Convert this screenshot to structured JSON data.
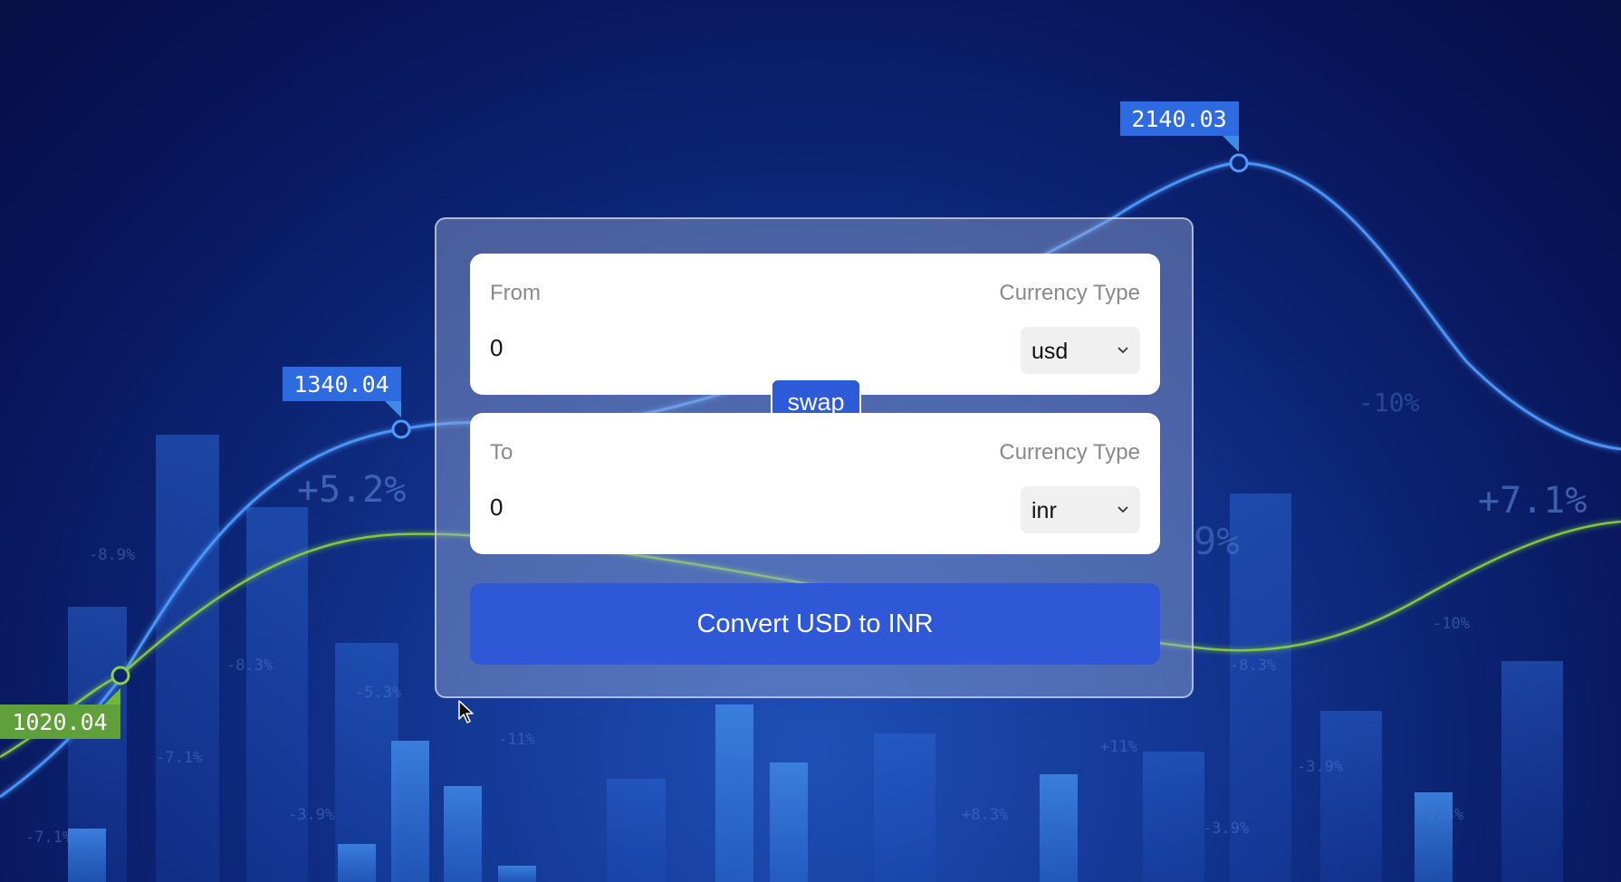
{
  "background": {
    "price_tags": [
      {
        "text": "2140.03",
        "color": "#2f6be0"
      },
      {
        "text": "1340.04",
        "color": "#2f6be0"
      },
      {
        "text": "1020.04",
        "color": "#5fa03a"
      }
    ],
    "percent_labels_large": [
      "+5.2%",
      "+7.1%",
      "-10%",
      "9%"
    ],
    "percent_labels_small": [
      "-8.9%",
      "-8.3%",
      "-5.3%",
      "-7.1%",
      "-3.9%",
      "-7.1%",
      "-11%",
      "+11%",
      "+8.3%",
      "-3.9%",
      "-3.9%",
      "-5.3%",
      "-8.3%",
      "-10%"
    ]
  },
  "converter": {
    "from": {
      "label": "From",
      "currency_label": "Currency Type",
      "amount": "0",
      "currency": "usd"
    },
    "swap_label": "swap",
    "to": {
      "label": "To",
      "currency_label": "Currency Type",
      "amount": "0",
      "currency": "inr"
    },
    "convert_label": "Convert USD to INR"
  },
  "colors": {
    "accent": "#2e58d6",
    "chart_line_blue": "#4d9bff",
    "chart_line_green": "#8cd23c"
  },
  "icons": {
    "dropdown": "chevron-down-icon",
    "pointer": "mouse-cursor-icon"
  }
}
